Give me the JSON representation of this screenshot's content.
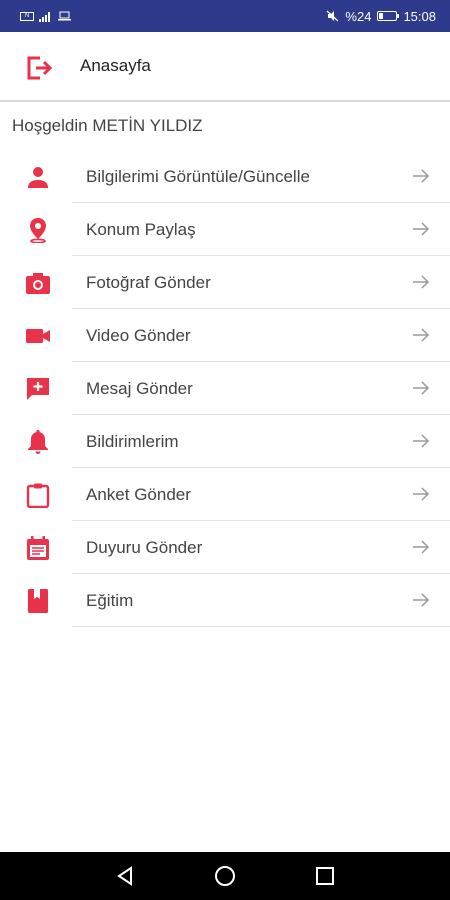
{
  "status_bar": {
    "battery_text": "%24",
    "time": "15:08",
    "battery_level": 0.24
  },
  "header": {
    "title": "Anasayfa",
    "icon": "exit-icon"
  },
  "welcome_text": "Hoşgeldin METİN YILDIZ",
  "menu": [
    {
      "label": "Bilgilerimi Görüntüle/Güncelle",
      "icon": "person-icon"
    },
    {
      "label": "Konum Paylaş",
      "icon": "location-pin-icon"
    },
    {
      "label": "Fotoğraf Gönder",
      "icon": "camera-icon"
    },
    {
      "label": "Video Gönder",
      "icon": "video-camera-icon"
    },
    {
      "label": "Mesaj Gönder",
      "icon": "add-message-icon"
    },
    {
      "label": "Bildirimlerim",
      "icon": "bell-icon"
    },
    {
      "label": "Anket Gönder",
      "icon": "clipboard-icon"
    },
    {
      "label": "Duyuru Gönder",
      "icon": "calendar-note-icon"
    },
    {
      "label": "Eğitim",
      "icon": "bookmark-icon"
    }
  ],
  "colors": {
    "status_bar": "#2e3a8c",
    "accent": "#e8334a",
    "nav_bar": "#000000"
  }
}
